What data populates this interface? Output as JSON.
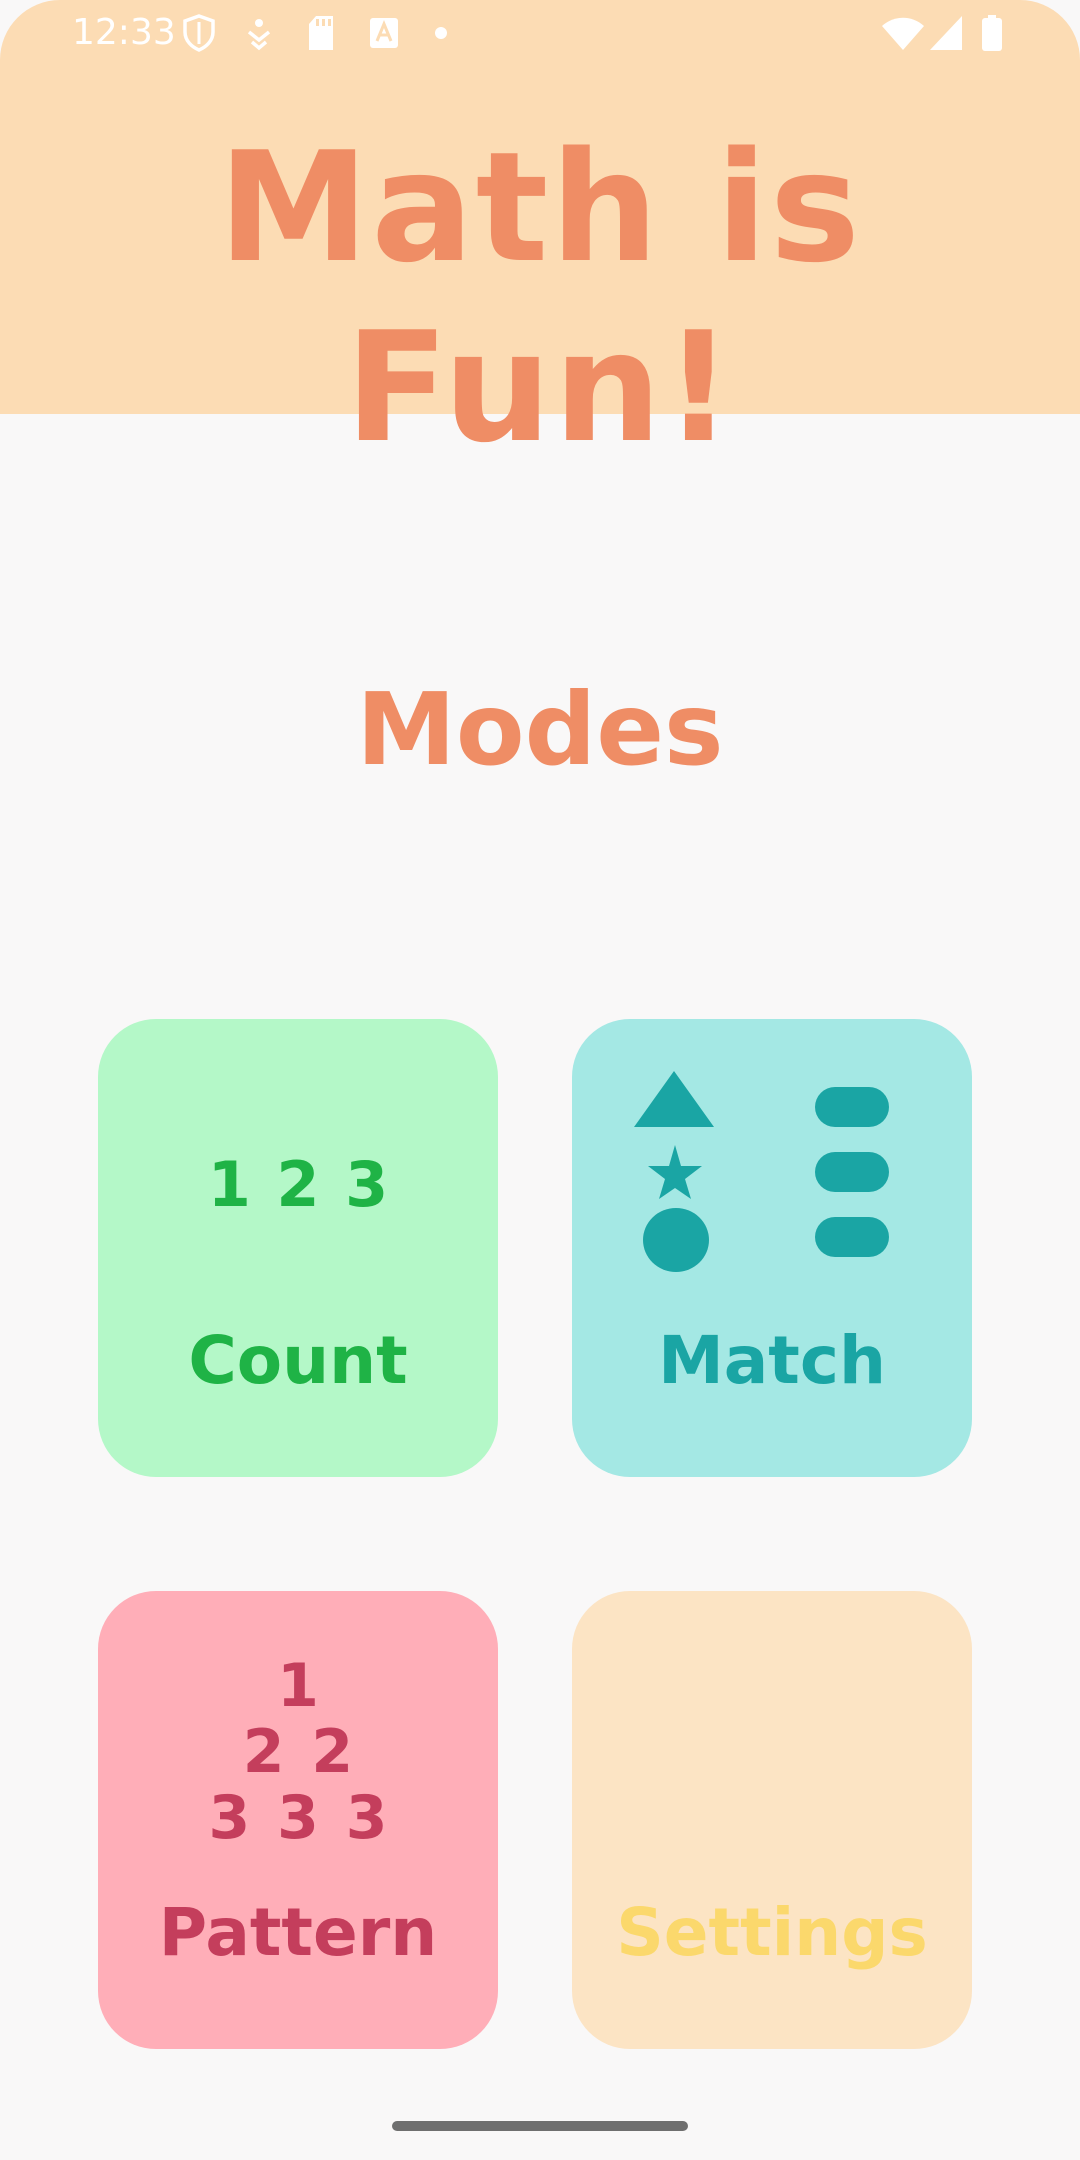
{
  "status_bar": {
    "time": "12:33"
  },
  "header": {
    "title": "Math is Fun!"
  },
  "main": {
    "section_title": "Modes",
    "modes": {
      "count": {
        "label": "Count",
        "icon_text": "1 2 3"
      },
      "match": {
        "label": "Match",
        "icon": "shapes-match-icon"
      },
      "pattern": {
        "label": "Pattern",
        "lines": [
          "1",
          "2 2",
          "3 3 3"
        ]
      },
      "settings": {
        "label": "Settings"
      }
    }
  },
  "colors": {
    "header_bg": "#fcdcb4",
    "title": "#ef8d65",
    "count_bg": "#b4f8c8",
    "count_fg": "#1fb346",
    "match_bg": "#a4e8e4",
    "match_fg": "#1aa5a4",
    "pattern_bg": "#ffaeb8",
    "pattern_fg": "#c43e5c",
    "settings_bg": "#fce4c4",
    "settings_fg": "#fbd86c"
  },
  "icons": [
    "shield-icon",
    "notification-icon",
    "sd-card-icon",
    "font-icon",
    "dot-icon",
    "wifi-icon",
    "signal-icon",
    "battery-icon"
  ]
}
